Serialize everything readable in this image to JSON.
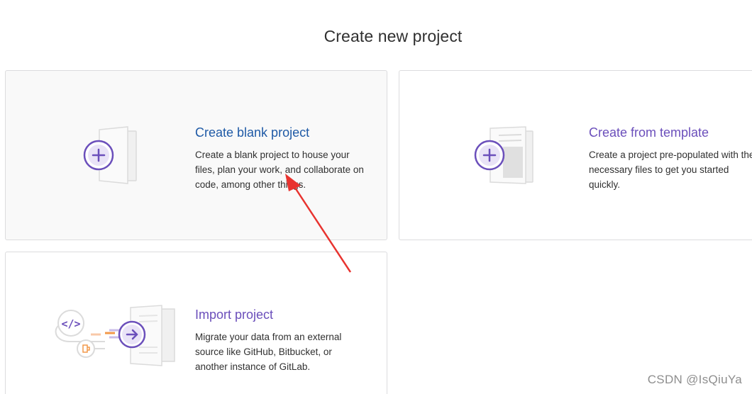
{
  "page": {
    "title": "Create new project"
  },
  "cards": {
    "blank": {
      "title": "Create blank project",
      "description": "Create a blank project to house your files, plan your work, and collaborate on code, among other things.",
      "icon": "plus-document-icon"
    },
    "template": {
      "title": "Create from template",
      "description": "Create a project pre-populated with the necessary files to get you started quickly.",
      "icon": "template-document-icon"
    },
    "import": {
      "title": "Import project",
      "description": "Migrate your data from an external source like GitHub, Bitbucket, or another instance of GitLab.",
      "icon": "import-illustration-icon"
    }
  },
  "annotation": {
    "color": "#e8332f",
    "description": "red arrow pointing at Create blank project description"
  },
  "watermark": "CSDN @IsQiuYa",
  "colors": {
    "blank_title": "#1f5aa6",
    "purple_title": "#6b4fbb",
    "accent_purple": "#6b4fbb",
    "card_border": "#dcdcde",
    "hover_bg": "#f9f9f9"
  }
}
